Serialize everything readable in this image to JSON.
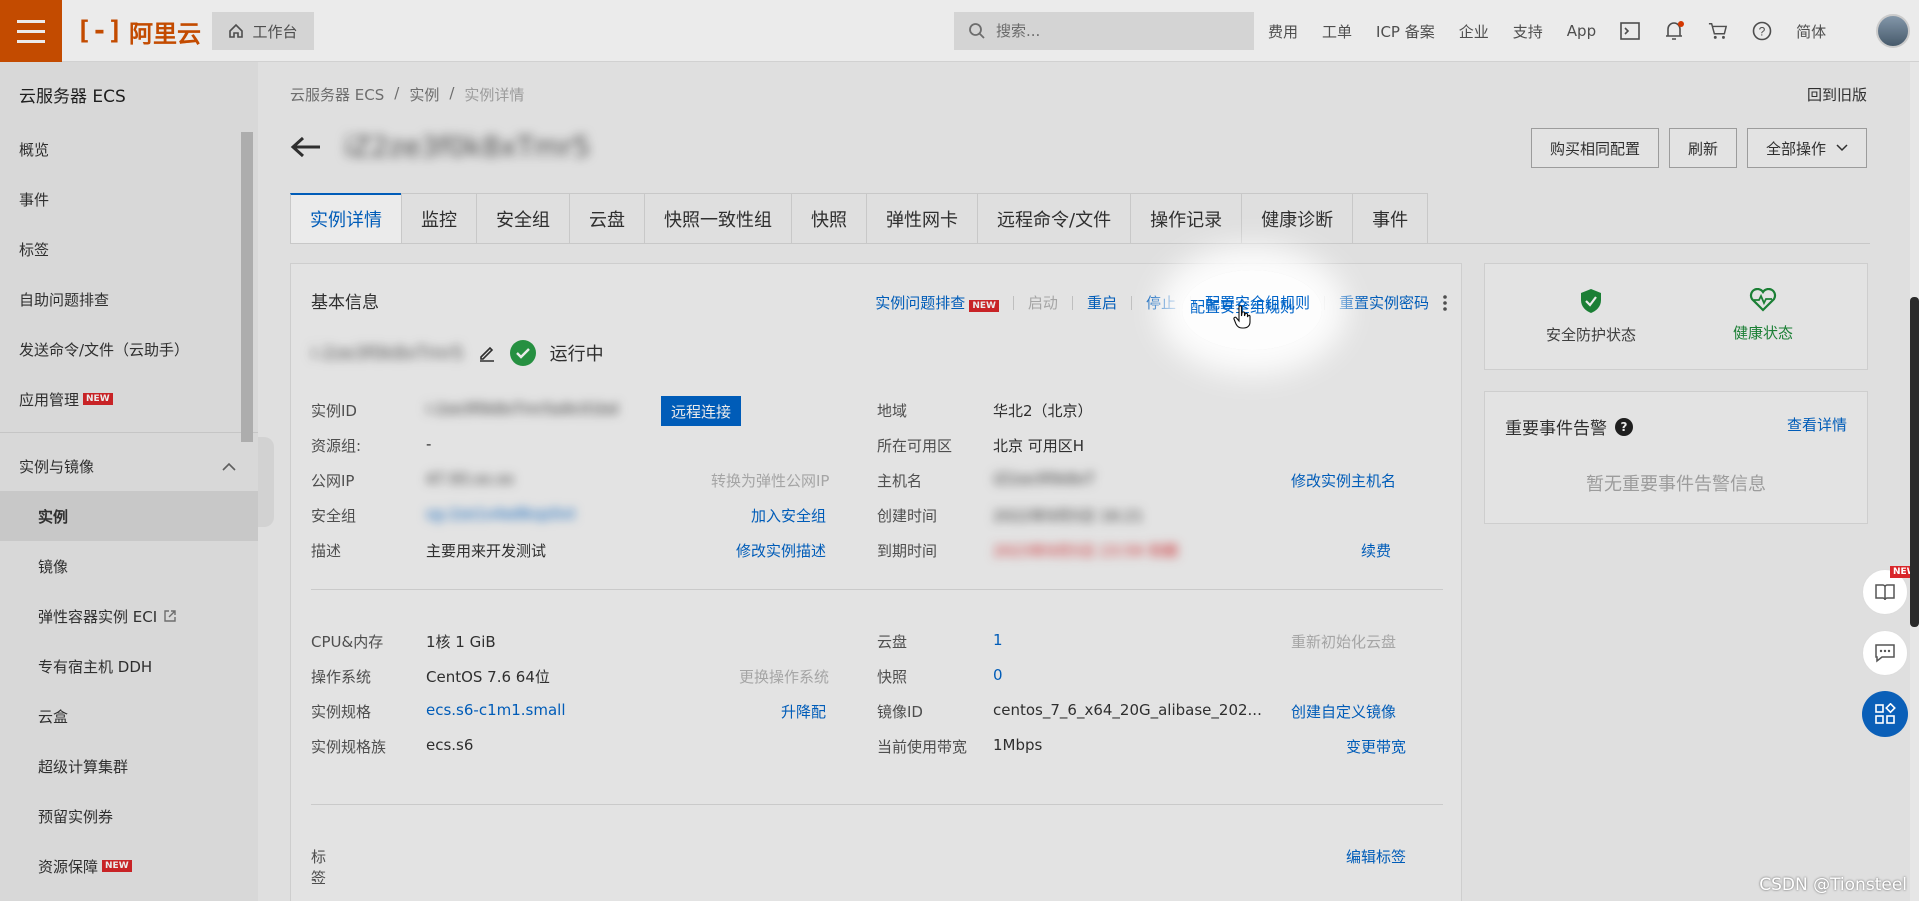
{
  "topbar": {
    "logo": "阿里云",
    "workbench": "工作台",
    "search_placeholder": "搜索...",
    "nav": [
      "费用",
      "工单",
      "ICP 备案",
      "企业",
      "支持",
      "App"
    ],
    "lang": "简体"
  },
  "sidebar": {
    "title": "云服务器 ECS",
    "items": [
      "概览",
      "事件",
      "标签",
      "自助问题排查",
      "发送命令/文件（云助手）",
      "应用管理"
    ],
    "group": "实例与镜像",
    "sub_items": [
      "实例",
      "镜像",
      "弹性容器实例 ECI",
      "专有宿主机 DDH",
      "云盒",
      "超级计算集群",
      "预留实例券",
      "资源保障"
    ],
    "new_tag": "NEW"
  },
  "breadcrumb": [
    "云服务器 ECS",
    "/",
    "实例",
    "/",
    "实例详情"
  ],
  "back_old": "回到旧版",
  "instance_name": "iZ2ze3f0k8xTmr5",
  "header_buttons": {
    "buy_same": "购买相同配置",
    "refresh": "刷新",
    "all_actions": "全部操作"
  },
  "tabs": [
    "实例详情",
    "监控",
    "安全组",
    "云盘",
    "快照一致性组",
    "快照",
    "弹性网卡",
    "远程命令/文件",
    "操作记录",
    "健康诊断",
    "事件"
  ],
  "basic": {
    "title": "基本信息",
    "actions": {
      "troubleshoot": "实例问题排查",
      "start": "启动",
      "restart": "重启",
      "stop": "停止",
      "config_sg": "配置安全组规则",
      "reset_pwd": "重置实例密码"
    },
    "status": "运行中",
    "blurred_name": "i-2ze3f0k8xTmr5",
    "remote_connect": "远程连接",
    "left_fields": [
      {
        "label": "实例ID",
        "value": "i-2ze3f0k8xTmr5a9c01bd",
        "link": ""
      },
      {
        "label": "资源组:",
        "value": "-",
        "link": ""
      },
      {
        "label": "公网IP",
        "value": "47.93.xx.xx",
        "link": "转换为弹性公网IP"
      },
      {
        "label": "安全组",
        "value": "sg-2ze1x4w8kqz0vt",
        "link": "加入安全组"
      },
      {
        "label": "描述",
        "value": "主要用来开发测试",
        "link": "修改实例描述"
      }
    ],
    "right_fields": [
      {
        "label": "地域",
        "value": "华北2（北京）",
        "link": ""
      },
      {
        "label": "所在可用区",
        "value": "北京 可用区H",
        "link": ""
      },
      {
        "label": "主机名",
        "value": "iZ2ze3f0k8xT",
        "link": "修改实例主机名"
      },
      {
        "label": "创建时间",
        "value": "2022年9月5日 16:21",
        "link": ""
      },
      {
        "label": "到期时间",
        "value": "2023年9月5日 23:59 到期",
        "link": "续费"
      }
    ],
    "spec_left": [
      {
        "label": "CPU&内存",
        "value": "1核 1 GiB",
        "link": ""
      },
      {
        "label": "操作系统",
        "value": "CentOS 7.6 64位",
        "link": "更换操作系统"
      },
      {
        "label": "实例规格",
        "value": "ecs.s6-c1m1.small",
        "link": "升降配"
      },
      {
        "label": "实例规格族",
        "value": "ecs.s6",
        "link": ""
      }
    ],
    "spec_right": [
      {
        "label": "云盘",
        "value": "1",
        "link": "重新初始化云盘"
      },
      {
        "label": "快照",
        "value": "0",
        "link": ""
      },
      {
        "label": "镜像ID",
        "value": "centos_7_6_x64_20G_alibase_202...",
        "link": "创建自定义镜像"
      },
      {
        "label": "当前使用带宽",
        "value": "1Mbps",
        "link": "变更带宽"
      }
    ],
    "tags_label": "标签",
    "tags_value": "-",
    "edit_tags": "编辑标签"
  },
  "status_panel": {
    "security": "安全防护状态",
    "health": "健康状态"
  },
  "events_panel": {
    "title": "重要事件告警",
    "view": "查看详情",
    "empty": "暂无重要事件告警信息"
  },
  "watermark": "CSDN @Tionsteel",
  "colors": {
    "brand": "#d45200",
    "link": "#0064c8",
    "success": "#2a9d47",
    "health": "#1e8a3a"
  }
}
